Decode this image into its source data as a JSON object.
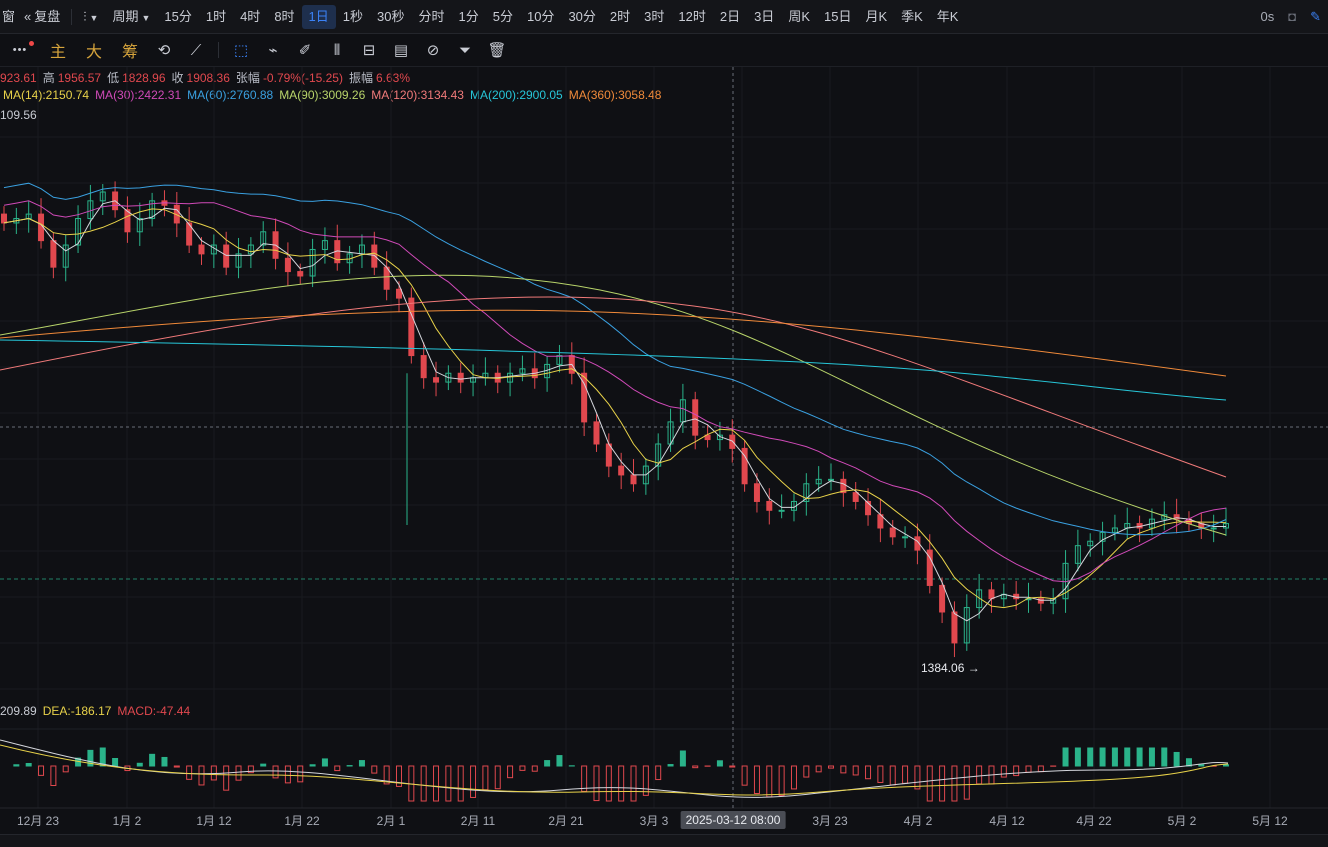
{
  "topbar": {
    "window_label": "窗",
    "fq_label": "复盘",
    "period_label": "周期",
    "periods": [
      "15分",
      "1时",
      "4时",
      "8时",
      "1日",
      "1秒",
      "30秒",
      "分时",
      "1分",
      "5分",
      "10分",
      "30分",
      "2时",
      "3时",
      "12时",
      "2日",
      "3日",
      "周K",
      "15日",
      "月K",
      "季K",
      "年K"
    ],
    "active_period": "1日",
    "latency": "0s"
  },
  "toolbar": {
    "more": "•••",
    "indicators": [
      "主",
      "大",
      "筹"
    ]
  },
  "ohlc": {
    "open_label": "",
    "open": "923.61",
    "high_label": "高",
    "high": "1956.57",
    "low_label": "低",
    "low": "1828.96",
    "close_label": "收",
    "close": "1908.36",
    "change_label": "张幅",
    "change": "-0.79%(-15.25)",
    "amp_label": "振幅",
    "amp": "6.63%"
  },
  "ma_legend": [
    {
      "text": "MA(14):2150.74",
      "color": "#e8d24a"
    },
    {
      "text": "MA(30):2422.31",
      "color": "#d04ab8"
    },
    {
      "text": "MA(60):2760.88",
      "color": "#3aa0e0"
    },
    {
      "text": "MA(90):3009.26",
      "color": "#b8d46a"
    },
    {
      "text": "MA(120):3134.43",
      "color": "#f07a7a"
    },
    {
      "text": "MA(200):2900.05",
      "color": "#27c6d8"
    },
    {
      "text": "MA(360):3058.48",
      "color": "#f08a3a"
    }
  ],
  "top_price_label": "109.56",
  "low_marker": "1384.06 →",
  "macd_legend": [
    {
      "text": "209.89",
      "color": "#c9ccd4"
    },
    {
      "text": "DEA:-186.17",
      "color": "#e8d24a"
    },
    {
      "text": "MACD:-47.44",
      "color": "#e0484e"
    }
  ],
  "x_axis": [
    "12月 23",
    "1月 2",
    "1月 12",
    "1月 22",
    "2月 1",
    "2月 11",
    "2月 21",
    "3月 3",
    "3月 23",
    "4月 2",
    "4月 12",
    "4月 22",
    "5月 2",
    "5月 12"
  ],
  "cursor_date": "2025-03-12 08:00",
  "colors": {
    "up": "#2ab38a",
    "down": "#e0484e",
    "bg": "#0f1014",
    "accent": "#3b82f6"
  },
  "chart_data": {
    "type": "candlestick",
    "close_series": [
      2350,
      2360,
      2370,
      2310,
      2250,
      2300,
      2360,
      2400,
      2420,
      2380,
      2330,
      2360,
      2400,
      2390,
      2350,
      2300,
      2280,
      2300,
      2250,
      2280,
      2300,
      2330,
      2270,
      2240,
      2230,
      2290,
      2310,
      2260,
      2280,
      2300,
      2250,
      2200,
      2180,
      2050,
      2000,
      1990,
      2010,
      1990,
      2000,
      2010,
      1990,
      2010,
      2020,
      2000,
      2030,
      2050,
      2010,
      1900,
      1850,
      1800,
      1780,
      1760,
      1800,
      1850,
      1900,
      1950,
      1870,
      1860,
      1870,
      1840,
      1760,
      1720,
      1700,
      1700,
      1720,
      1760,
      1770,
      1770,
      1740,
      1720,
      1690,
      1660,
      1640,
      1640,
      1610,
      1530,
      1470,
      1400,
      1480,
      1520,
      1500,
      1510,
      1500,
      1500,
      1490,
      1500,
      1580,
      1620,
      1630,
      1650,
      1660,
      1670,
      1660,
      1680,
      1690,
      1680,
      1670,
      1660,
      1660,
      1670
    ],
    "low_value": 1384.06
  }
}
